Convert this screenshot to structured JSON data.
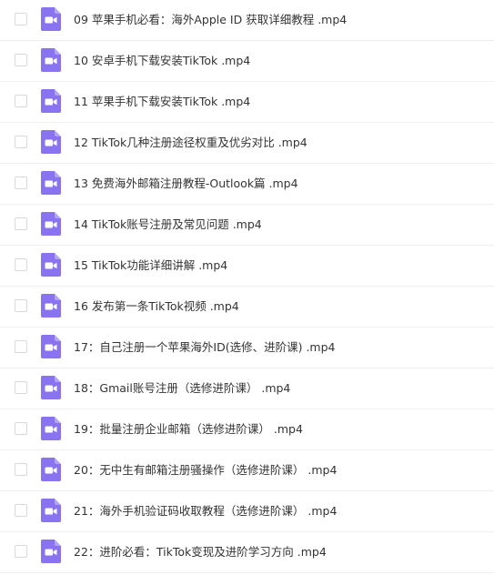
{
  "colors": {
    "icon_fill": "#8a73f0",
    "icon_glyph": "#ffffff",
    "text": "#333333",
    "divider": "#eeeeee",
    "checkbox_border": "#d9d9d9"
  },
  "file_icon": "video-file-icon",
  "files": [
    {
      "name": "09 苹果手机必看：海外Apple ID 获取详细教程 .mp4"
    },
    {
      "name": "10 安卓手机下载安装TikTok .mp4"
    },
    {
      "name": "11 苹果手机下载安装TikTok .mp4"
    },
    {
      "name": "12 TikTok几种注册途径权重及优劣对比 .mp4"
    },
    {
      "name": "13 免费海外邮箱注册教程-Outlook篇 .mp4"
    },
    {
      "name": "14 TikTok账号注册及常见问题 .mp4"
    },
    {
      "name": "15 TikTok功能详细讲解 .mp4"
    },
    {
      "name": "16 发布第一条TikTok视频 .mp4"
    },
    {
      "name": "17：自己注册一个苹果海外ID(选修、进阶课) .mp4"
    },
    {
      "name": "18：Gmail账号注册（选修进阶课） .mp4"
    },
    {
      "name": "19：批量注册企业邮箱（选修进阶课） .mp4"
    },
    {
      "name": "20：无中生有邮箱注册骚操作（选修进阶课） .mp4"
    },
    {
      "name": "21：海外手机验证码收取教程（选修进阶课） .mp4"
    },
    {
      "name": "22：进阶必看：TikTok变现及进阶学习方向 .mp4"
    }
  ]
}
